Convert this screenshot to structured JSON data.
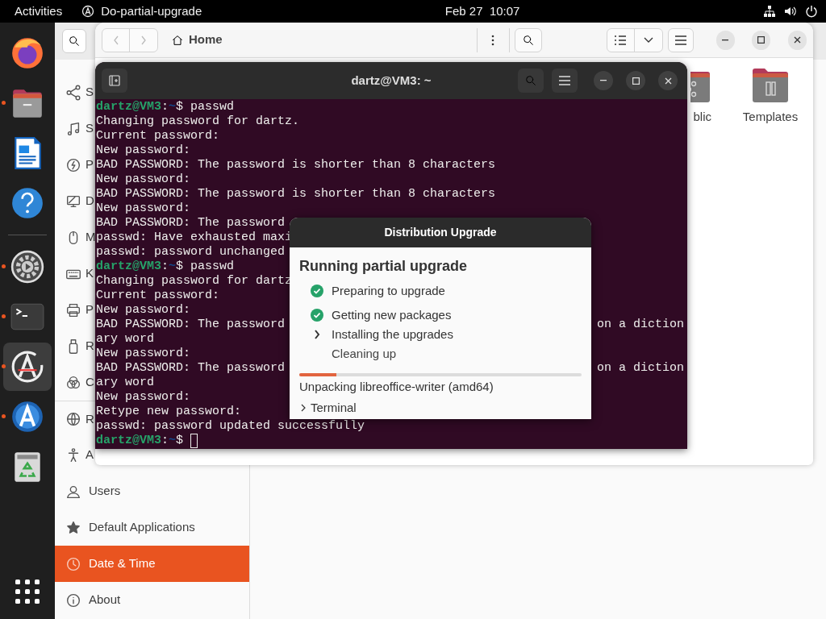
{
  "top_bar": {
    "activities": "Activities",
    "app_name": "Do-partial-upgrade",
    "clock": "Feb 27  10:07"
  },
  "dock": {
    "items": [
      {
        "kind": "firefox",
        "running": false,
        "focused": false
      },
      {
        "kind": "files",
        "running": true,
        "focused": false
      },
      {
        "kind": "writer",
        "running": false,
        "focused": false
      },
      {
        "kind": "help",
        "running": false,
        "focused": false
      },
      {
        "kind": "settings",
        "running": true,
        "focused": false
      },
      {
        "kind": "terminal",
        "running": true,
        "focused": false
      },
      {
        "kind": "updater",
        "running": true,
        "focused": true
      },
      {
        "kind": "store",
        "running": true,
        "focused": false
      },
      {
        "kind": "trash",
        "running": false,
        "focused": false
      }
    ]
  },
  "settings": {
    "sidebar": [
      {
        "label": "S",
        "kind": "share",
        "selected": false
      },
      {
        "label": "S",
        "kind": "music",
        "selected": false
      },
      {
        "label": "P",
        "kind": "power",
        "selected": false
      },
      {
        "label": "D",
        "kind": "display",
        "selected": false
      },
      {
        "label": "M",
        "kind": "mouse",
        "selected": false
      },
      {
        "label": "K",
        "kind": "keyboard",
        "selected": false
      },
      {
        "label": "P",
        "kind": "printer",
        "selected": false
      },
      {
        "label": "R",
        "kind": "usb",
        "selected": false
      },
      {
        "label": "C",
        "kind": "color",
        "selected": false
      },
      {
        "label": "R",
        "kind": "globe",
        "selected": false
      },
      {
        "label": "A",
        "kind": "person",
        "selected": false
      },
      {
        "label": "Users",
        "kind": "users",
        "selected": false
      },
      {
        "label": "Default Applications",
        "kind": "star",
        "selected": false
      },
      {
        "label": "Date & Time",
        "kind": "clock",
        "selected": true
      },
      {
        "label": "About",
        "kind": "info",
        "selected": false
      }
    ]
  },
  "files": {
    "path": "Home",
    "folders": [
      {
        "label": "blic",
        "kind": "share"
      },
      {
        "label": "Templates",
        "kind": "template"
      }
    ]
  },
  "terminal": {
    "title": "dartz@VM3: ~",
    "lines": [
      {
        "kind": "prompt",
        "user": "dartz@VM3",
        "sep": ":",
        "path": "~",
        "sign": "$",
        "command": "passwd",
        "cursor": false
      },
      {
        "kind": "output",
        "text": "Changing password for dartz."
      },
      {
        "kind": "output",
        "text": "Current password:"
      },
      {
        "kind": "output",
        "text": "New password:"
      },
      {
        "kind": "output",
        "text": "BAD PASSWORD: The password is shorter than 8 characters"
      },
      {
        "kind": "output",
        "text": "New password:"
      },
      {
        "kind": "output",
        "text": "BAD PASSWORD: The password is shorter than 8 characters"
      },
      {
        "kind": "output",
        "text": "New password:"
      },
      {
        "kind": "output",
        "text": "BAD PASSWORD: The password"
      },
      {
        "kind": "output",
        "text": "passwd: Have exhausted maxi"
      },
      {
        "kind": "output",
        "text": "passwd: password unchanged"
      },
      {
        "kind": "prompt",
        "user": "dartz@VM3",
        "sep": ":",
        "path": "~",
        "sign": "$",
        "command": "passwd",
        "cursor": false
      },
      {
        "kind": "output",
        "text": "Changing password for dartz"
      },
      {
        "kind": "output",
        "text": "Current password:"
      },
      {
        "kind": "output",
        "text": "New password:"
      },
      {
        "kind": "split",
        "text": "BAD PASSWORD: The password",
        "tail": "on a diction"
      },
      {
        "kind": "output",
        "text": "ary word"
      },
      {
        "kind": "output",
        "text": "New password:"
      },
      {
        "kind": "split",
        "text": "BAD PASSWORD: The password",
        "tail": "on a diction"
      },
      {
        "kind": "output",
        "text": "ary word"
      },
      {
        "kind": "output",
        "text": "New password:"
      },
      {
        "kind": "output",
        "text": "Retype new password:"
      },
      {
        "kind": "output",
        "text": "passwd: password updated successfully"
      },
      {
        "kind": "prompt",
        "user": "dartz@VM3",
        "sep": ":",
        "path": "~",
        "sign": "$",
        "cursor": true
      }
    ]
  },
  "dialog": {
    "title": "Distribution Upgrade",
    "heading": "Running partial upgrade",
    "steps": [
      {
        "label": "Preparing to upgrade",
        "kind": "done"
      },
      {
        "label": "Getting new packages",
        "kind": "done"
      },
      {
        "label": "Installing the upgrades",
        "kind": "current"
      },
      {
        "label": "Cleaning up",
        "kind": "pending"
      }
    ],
    "progress": {
      "level": 0.13
    },
    "status_text": "Unpacking libreoffice-writer (amd64)",
    "details": {
      "label": "Terminal",
      "expanded": false
    }
  }
}
